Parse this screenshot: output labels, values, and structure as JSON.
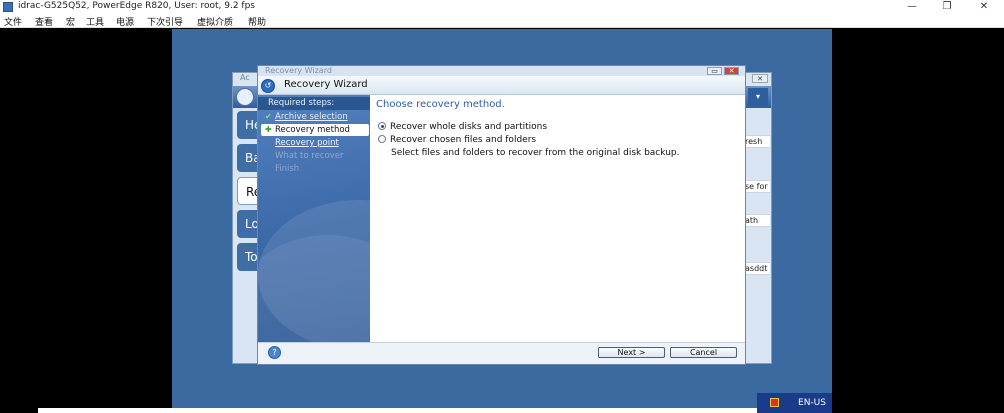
{
  "host": {
    "title": "idrac-G525Q52, PowerEdge R820, User: root, 9.2 fps",
    "controls": [
      "—",
      "❐",
      "✕"
    ],
    "menu": [
      "文件",
      "查看",
      "宏",
      "工具",
      "电源",
      "下次引导",
      "虚拟介质",
      "帮助"
    ]
  },
  "background_app": {
    "title": "Ac",
    "nav_tabs": [
      "He",
      "Ba",
      "Re",
      "Lo",
      "To"
    ],
    "right_snippets": [
      "resh",
      "se for",
      "ath",
      "asddt"
    ]
  },
  "wizard": {
    "window_title": "Recovery Wizard",
    "header_title": "Recovery Wizard",
    "steps_header": "Required steps:",
    "steps": [
      {
        "label": "Archive selection",
        "state": "done"
      },
      {
        "label": "Recovery method",
        "state": "current"
      },
      {
        "label": "Recovery point",
        "state": "link"
      },
      {
        "label": "What to recover",
        "state": "disabled"
      },
      {
        "label": "Finish",
        "state": "disabled"
      }
    ],
    "main_title": "Choose recovery method.",
    "options": [
      {
        "label": "Recover whole disks and partitions",
        "selected": true
      },
      {
        "label": "Recover chosen files and folders",
        "selected": false
      }
    ],
    "option_description": "Select files and folders to recover from the original disk backup.",
    "buttons": {
      "next": "Next >",
      "cancel": "Cancel"
    }
  },
  "taskbar": {
    "language": "EN-US"
  },
  "colors": {
    "desktop": "#3b6aa0",
    "sidebar": "#3c69a8",
    "accent_title": "#2b5ea8"
  }
}
